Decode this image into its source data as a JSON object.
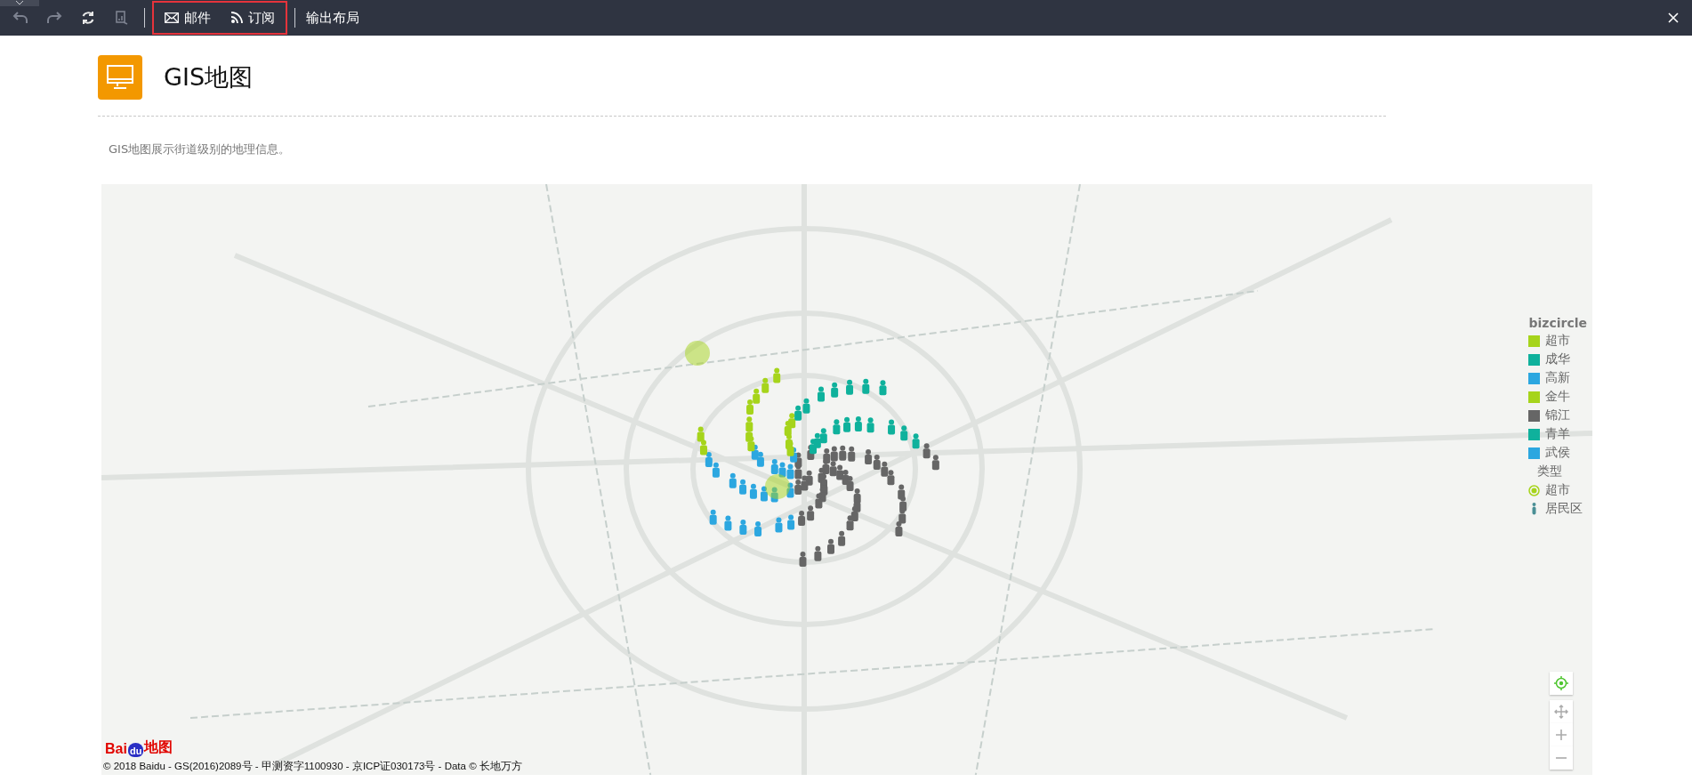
{
  "toolbar": {
    "history_buttons": [
      {
        "kind": "undo",
        "disabled": true
      },
      {
        "kind": "redo",
        "disabled": true
      },
      {
        "kind": "refresh",
        "disabled": false
      },
      {
        "kind": "export",
        "disabled": true
      }
    ],
    "share_group": {
      "highlighted": true,
      "items": [
        {
          "kind": "mail",
          "label": "邮件"
        },
        {
          "kind": "rss",
          "label": "订阅"
        }
      ]
    },
    "layout_button": {
      "label": "输出布局"
    }
  },
  "header": {
    "title": "GIS地图",
    "description": "GIS地图展示街道级别的地理信息。"
  },
  "map": {
    "legend": {
      "title": "bizcircle",
      "items": [
        {
          "label": "超市",
          "color": "#a6d41b"
        },
        {
          "label": "成华",
          "color": "#0fb19c"
        },
        {
          "label": "高新",
          "color": "#2ca7e0"
        },
        {
          "label": "金牛",
          "color": "#a6d41b"
        },
        {
          "label": "锦江",
          "color": "#666666"
        },
        {
          "label": "青羊",
          "color": "#0fb19c"
        },
        {
          "label": "武侯",
          "color": "#2ca7e0"
        }
      ],
      "type_title": "类型",
      "types": [
        {
          "kind": "ring",
          "label": "超市"
        },
        {
          "kind": "person",
          "label": "居民区"
        }
      ]
    },
    "logo": {
      "left": "Bai",
      "paw": "du",
      "right": "地图"
    },
    "copyright": "© 2018 Baidu - GS(2016)2089号 - 甲测资字1100930 - 京ICP证030173号 - Data © 长地万方"
  }
}
